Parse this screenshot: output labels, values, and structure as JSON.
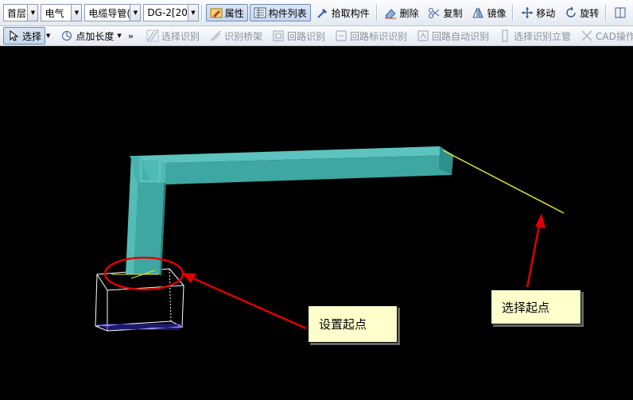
{
  "toolbar1": {
    "floor_value": "首层",
    "discipline_value": "电气",
    "type_value": "电缆导管(",
    "component_value": "DG-2[20",
    "properties_label": "属性",
    "component_list_label": "构件列表",
    "pick_component_label": "拾取构件",
    "delete_label": "删除",
    "copy_label": "复制",
    "mirror_label": "镜像",
    "move_label": "移动",
    "rotate_label": "旋转"
  },
  "toolbar2": {
    "select_label": "选择",
    "point_length_label": "点加长度",
    "select_identify_label": "选择识别",
    "identify_bridge_label": "识别桥架",
    "loop_identify_label": "回路识别",
    "loop_mark_identify_label": "回路标识识别",
    "loop_auto_identify_label": "回路自动识别",
    "select_identify_riser_label": "选择识别立管",
    "cad_ops_label": "CAD操作设置"
  },
  "annotations": {
    "set_start_point": "设置起点",
    "select_start_point": "选择起点"
  },
  "colors": {
    "pipe_fill": "#3ea7a2",
    "guide_line": "#e6e62e",
    "annotation_red": "#e00000",
    "callout_bg": "#ffffcc"
  }
}
